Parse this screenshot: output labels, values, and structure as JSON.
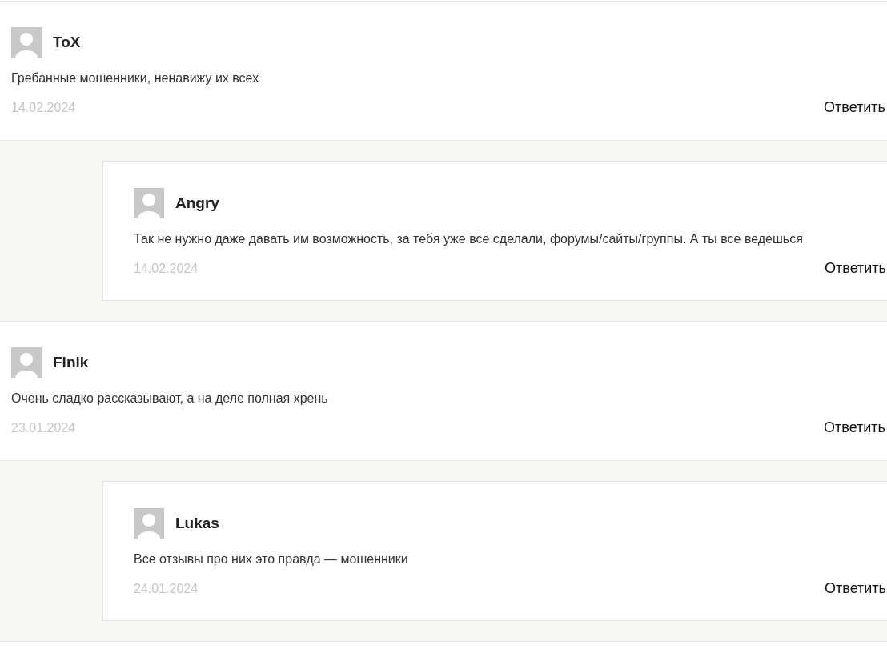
{
  "comments": [
    {
      "author": "ToX",
      "text": "Гребанные мошенники, ненавижу их всех",
      "date": "14.02.2024",
      "reply_label": "Ответить",
      "children": [
        {
          "author": "Angry",
          "text": "Так не нужно даже давать им возможность, за тебя уже все сделали, форумы/сайты/группы. А ты все ведешься",
          "date": "14.02.2024",
          "reply_label": "Ответить"
        }
      ]
    },
    {
      "author": "Finik",
      "text": "Очень сладко рассказывают, а на деле полная хрень",
      "date": "23.01.2024",
      "reply_label": "Ответить",
      "children": [
        {
          "author": "Lukas",
          "text": "Все отзывы про них это правда — мошенники",
          "date": "24.01.2024",
          "reply_label": "Ответить"
        }
      ]
    }
  ]
}
